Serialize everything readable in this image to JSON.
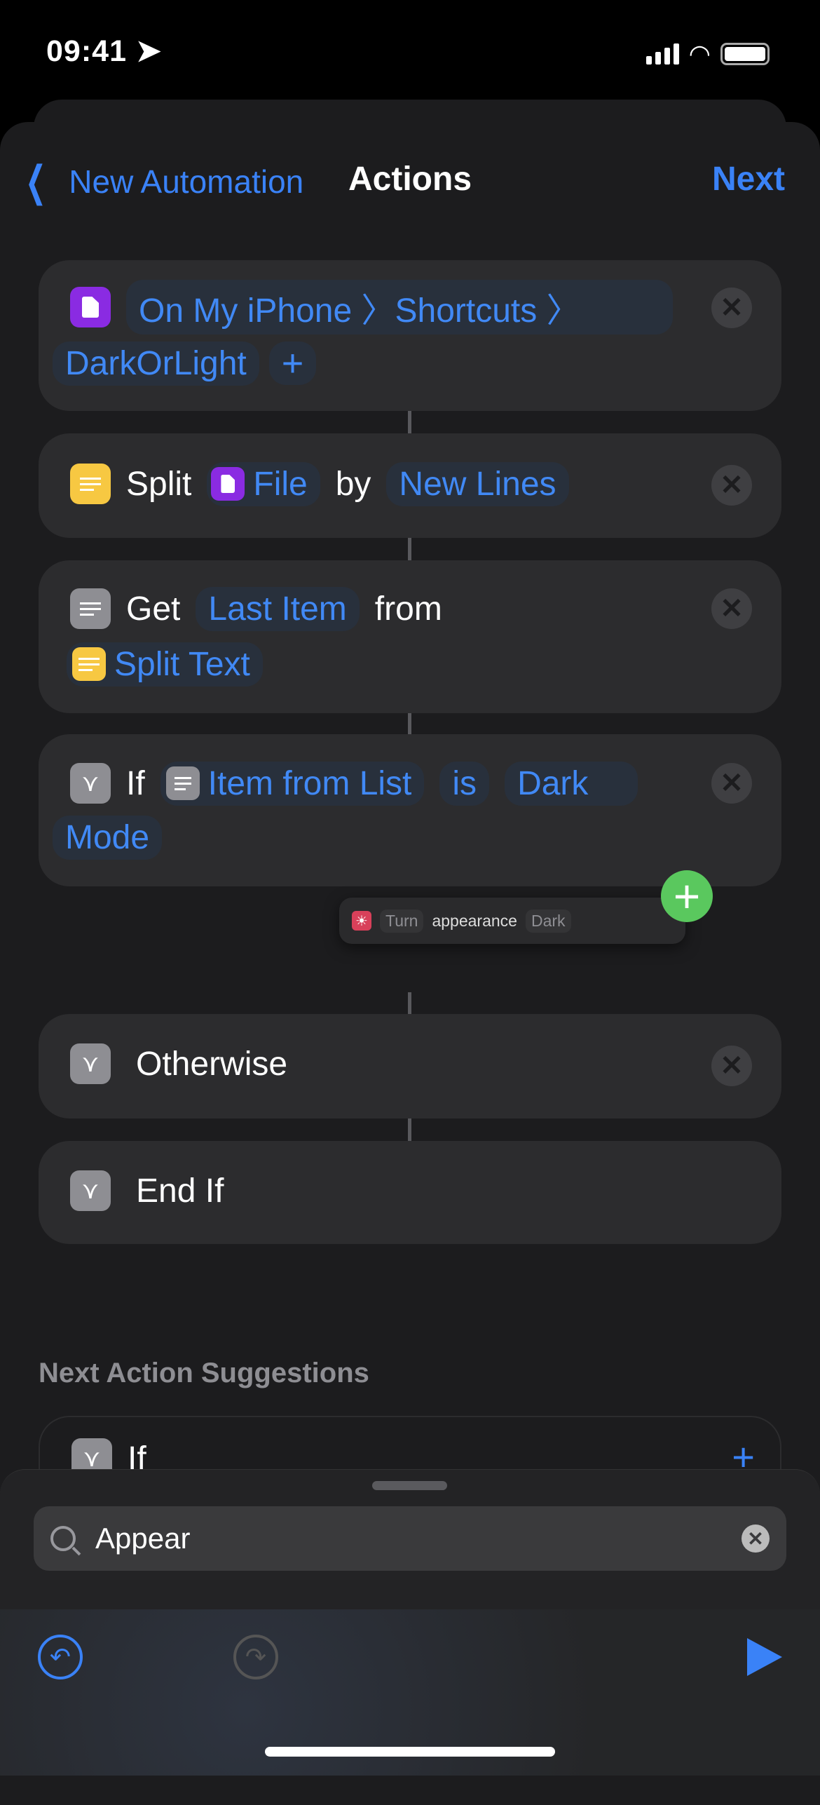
{
  "status": {
    "time": "09:41"
  },
  "nav": {
    "back_label": "New Automation",
    "title": "Actions",
    "next_label": "Next"
  },
  "actions": [
    {
      "path": "On My iPhone 〉Shortcuts 〉",
      "file": "DarkOrLight"
    },
    {
      "verb": "Split",
      "input": "File",
      "by": "by",
      "separator": "New Lines"
    },
    {
      "verb": "Get",
      "item": "Last Item",
      "from": "from",
      "source": "Split Text"
    },
    {
      "verb": "If",
      "input": "Item from List",
      "op": "is",
      "value1": "Dark",
      "value2": "Mode"
    },
    {
      "label": "Otherwise"
    },
    {
      "label": "End If"
    }
  ],
  "drag": {
    "turn": "Turn",
    "appearance": "appearance",
    "value": "Dark"
  },
  "suggestions": {
    "title": "Next Action Suggestions",
    "items": [
      {
        "label": "If"
      }
    ]
  },
  "search": {
    "value": "Appear"
  },
  "colors": {
    "accent": "#3a82f7",
    "add": "#5ac85e"
  }
}
